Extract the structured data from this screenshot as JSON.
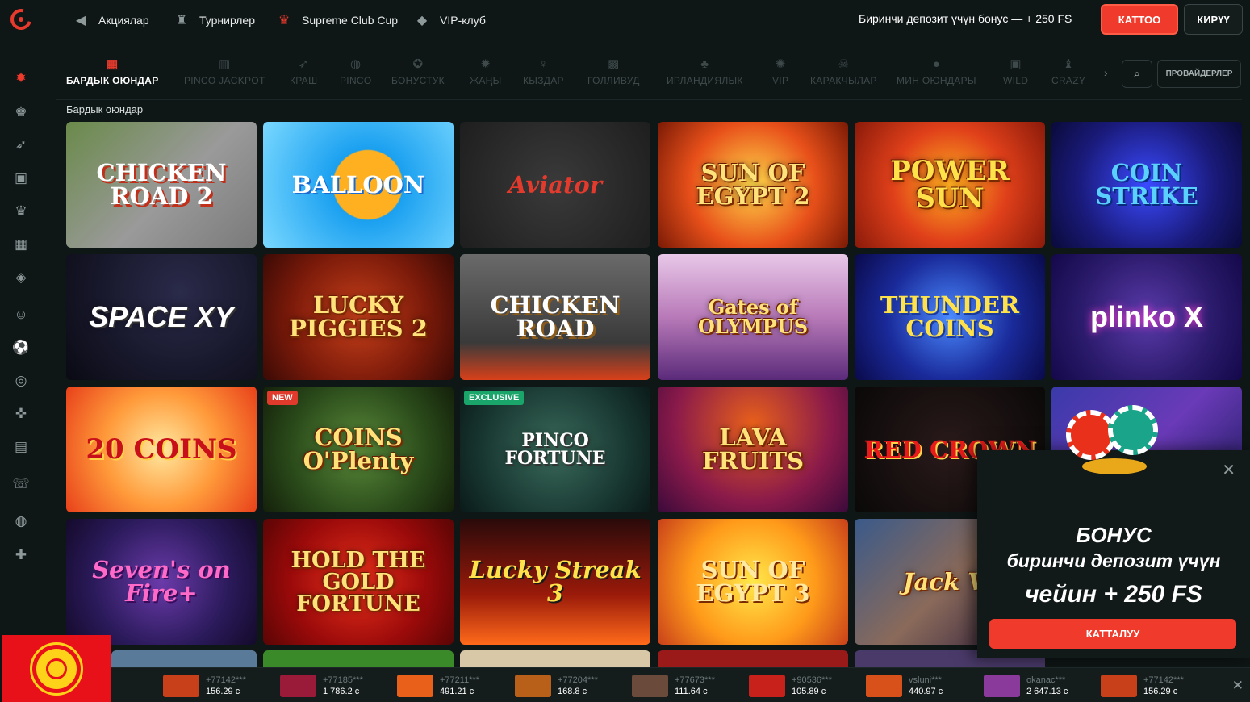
{
  "nav": {
    "promos": [
      {
        "label": "Акциялар",
        "icon": "megaphone-icon"
      },
      {
        "label": "Турнирлер",
        "icon": "trophy-icon"
      },
      {
        "label": "Supreme Club Cup",
        "icon": "cup-icon"
      },
      {
        "label": "VIP-клуб",
        "icon": "diamond-icon"
      }
    ],
    "bonus_text": "Биринчи депозит үчүн бонус — + 250 FS",
    "register_label": "КАТТОО",
    "login_label": "КИРҮҮ"
  },
  "sidebar": {
    "icons": [
      "casino-chip-icon",
      "live-dealer-icon",
      "rocket-icon",
      "tv-icon",
      "vip-icon",
      "slots-icon",
      "ticket-icon",
      "joker-icon",
      "soccer-icon",
      "target-icon",
      "gamepad-icon",
      "news-icon",
      "support-icon",
      "pinco-icon",
      "gift-icon"
    ]
  },
  "categories": [
    {
      "label": "БАРДЫК ОЮНДАР",
      "icon": "grid-icon",
      "active": true
    },
    {
      "label": "PINCO JACKPOT",
      "icon": "jackpot-icon"
    },
    {
      "label": "КРАШ",
      "icon": "rocket-icon"
    },
    {
      "label": "PINCO",
      "icon": "pinco-icon"
    },
    {
      "label": "БОНУСТУК",
      "icon": "bonus-icon"
    },
    {
      "label": "ЖАҢЫ",
      "icon": "new-icon"
    },
    {
      "label": "КЫЗДАР",
      "icon": "girl-icon"
    },
    {
      "label": "ГОЛЛИВУД",
      "icon": "camera-icon"
    },
    {
      "label": "ИРЛАНДИЯЛЫК",
      "icon": "clover-icon"
    },
    {
      "label": "VIP",
      "icon": "vip-icon"
    },
    {
      "label": "КАРАКЧЫЛАР",
      "icon": "skull-icon"
    },
    {
      "label": "МИН ОЮНДАРЫ",
      "icon": "bomb-icon"
    },
    {
      "label": "WILD",
      "icon": "wild-icon"
    },
    {
      "label": "CRAZY",
      "icon": "crazy-icon"
    }
  ],
  "providers_label": "ПРОВАЙДЕРЛЕР",
  "section_title": "Бардык оюндар",
  "games": [
    {
      "title": "CHICKEN ROAD 2",
      "tag": ""
    },
    {
      "title": "BALLOON",
      "tag": ""
    },
    {
      "title": "Aviator",
      "tag": ""
    },
    {
      "title": "SUN OF EGYPT 2",
      "tag": ""
    },
    {
      "title": "POWER SUN",
      "tag": ""
    },
    {
      "title": "COIN STRIKE",
      "tag": ""
    },
    {
      "title": "SPACE XY",
      "tag": ""
    },
    {
      "title": "LUCKY PIGGIES 2",
      "tag": ""
    },
    {
      "title": "CHICKEN ROAD",
      "tag": ""
    },
    {
      "title": "Gates of OLYMPUS",
      "tag": ""
    },
    {
      "title": "THUNDER COINS",
      "tag": ""
    },
    {
      "title": "plinko X",
      "tag": ""
    },
    {
      "title": "20 COINS",
      "tag": ""
    },
    {
      "title": "COINS O'Plenty",
      "tag": "NEW"
    },
    {
      "title": "PINCO FORTUNE",
      "tag": "EXCLUSIVE"
    },
    {
      "title": "LAVA FRUITS",
      "tag": ""
    },
    {
      "title": "RED CROWN",
      "tag": ""
    },
    {
      "title": "",
      "tag": ""
    },
    {
      "title": "Seven's on Fire+",
      "tag": ""
    },
    {
      "title": "HOLD THE GOLD FORTUNE",
      "tag": ""
    },
    {
      "title": "Lucky Streak 3",
      "tag": ""
    },
    {
      "title": "SUN OF EGYPT 3",
      "tag": ""
    },
    {
      "title": "Jack VI",
      "tag": ""
    }
  ],
  "popup": {
    "line1": "БОНУС",
    "line2": "биринчи депозит үчүн",
    "line3": "чейин + 250 FS",
    "button": "КАТТАЛУУ"
  },
  "ticker": [
    {
      "user": "+77142***",
      "amount": "156.29 c"
    },
    {
      "user": "+77185***",
      "amount": "1 786.2 c"
    },
    {
      "user": "+77211***",
      "amount": "491.21 c"
    },
    {
      "user": "+77204***",
      "amount": "168.8 c"
    },
    {
      "user": "+77673***",
      "amount": "111.64 c"
    },
    {
      "user": "+90536***",
      "amount": "105.89 c"
    },
    {
      "user": "vsluni***",
      "amount": "440.97 c"
    },
    {
      "user": "okanac***",
      "amount": "2 647.13 c"
    },
    {
      "user": "+77142***",
      "amount": "156.29 c"
    }
  ]
}
